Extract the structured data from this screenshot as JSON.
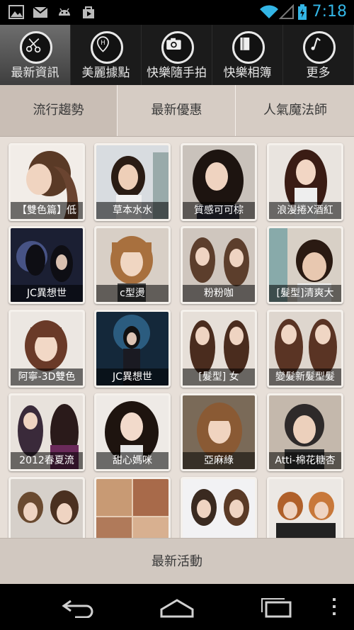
{
  "status": {
    "time": "7:18",
    "left_icons": [
      "image-icon",
      "gmail-icon",
      "android-icon",
      "play-store-icon"
    ],
    "right_icons": [
      "wifi-icon",
      "signal-icon",
      "battery-icon"
    ],
    "accent": "#33b5e5"
  },
  "tabs": [
    {
      "label": "最新資訊",
      "icon": "scissors-icon"
    },
    {
      "label": "美麗據點",
      "icon": "map-pin-icon"
    },
    {
      "label": "快樂隨手拍",
      "icon": "camera-icon"
    },
    {
      "label": "快樂相簿",
      "icon": "album-icon"
    },
    {
      "label": "更多",
      "icon": "music-note-icon"
    }
  ],
  "segments": [
    "流行趨勢",
    "最新優惠",
    "人氣魔法師"
  ],
  "tiles": [
    {
      "caption": "【雙色篇】低"
    },
    {
      "caption": "草本水水"
    },
    {
      "caption": "質感可可棕"
    },
    {
      "caption": "浪漫捲X酒紅"
    },
    {
      "caption": "JC異想世"
    },
    {
      "caption": "c型燙"
    },
    {
      "caption": "粉粉咖"
    },
    {
      "caption": "[髮型]清爽大"
    },
    {
      "caption": "阿寧-3D雙色"
    },
    {
      "caption": "JC異想世"
    },
    {
      "caption": "[髮型] 女"
    },
    {
      "caption": "變髮新髮型髮"
    },
    {
      "caption": "2012春夏流"
    },
    {
      "caption": "甜心媽咪"
    },
    {
      "caption": "亞麻綠"
    },
    {
      "caption": "Atti-棉花糖杏"
    },
    {
      "caption": ""
    },
    {
      "caption": ""
    },
    {
      "caption": ""
    },
    {
      "caption": ""
    }
  ],
  "bottom_button": "最新活動",
  "nav": [
    "back-icon",
    "home-icon",
    "recent-apps-icon",
    "overflow-menu-icon"
  ]
}
